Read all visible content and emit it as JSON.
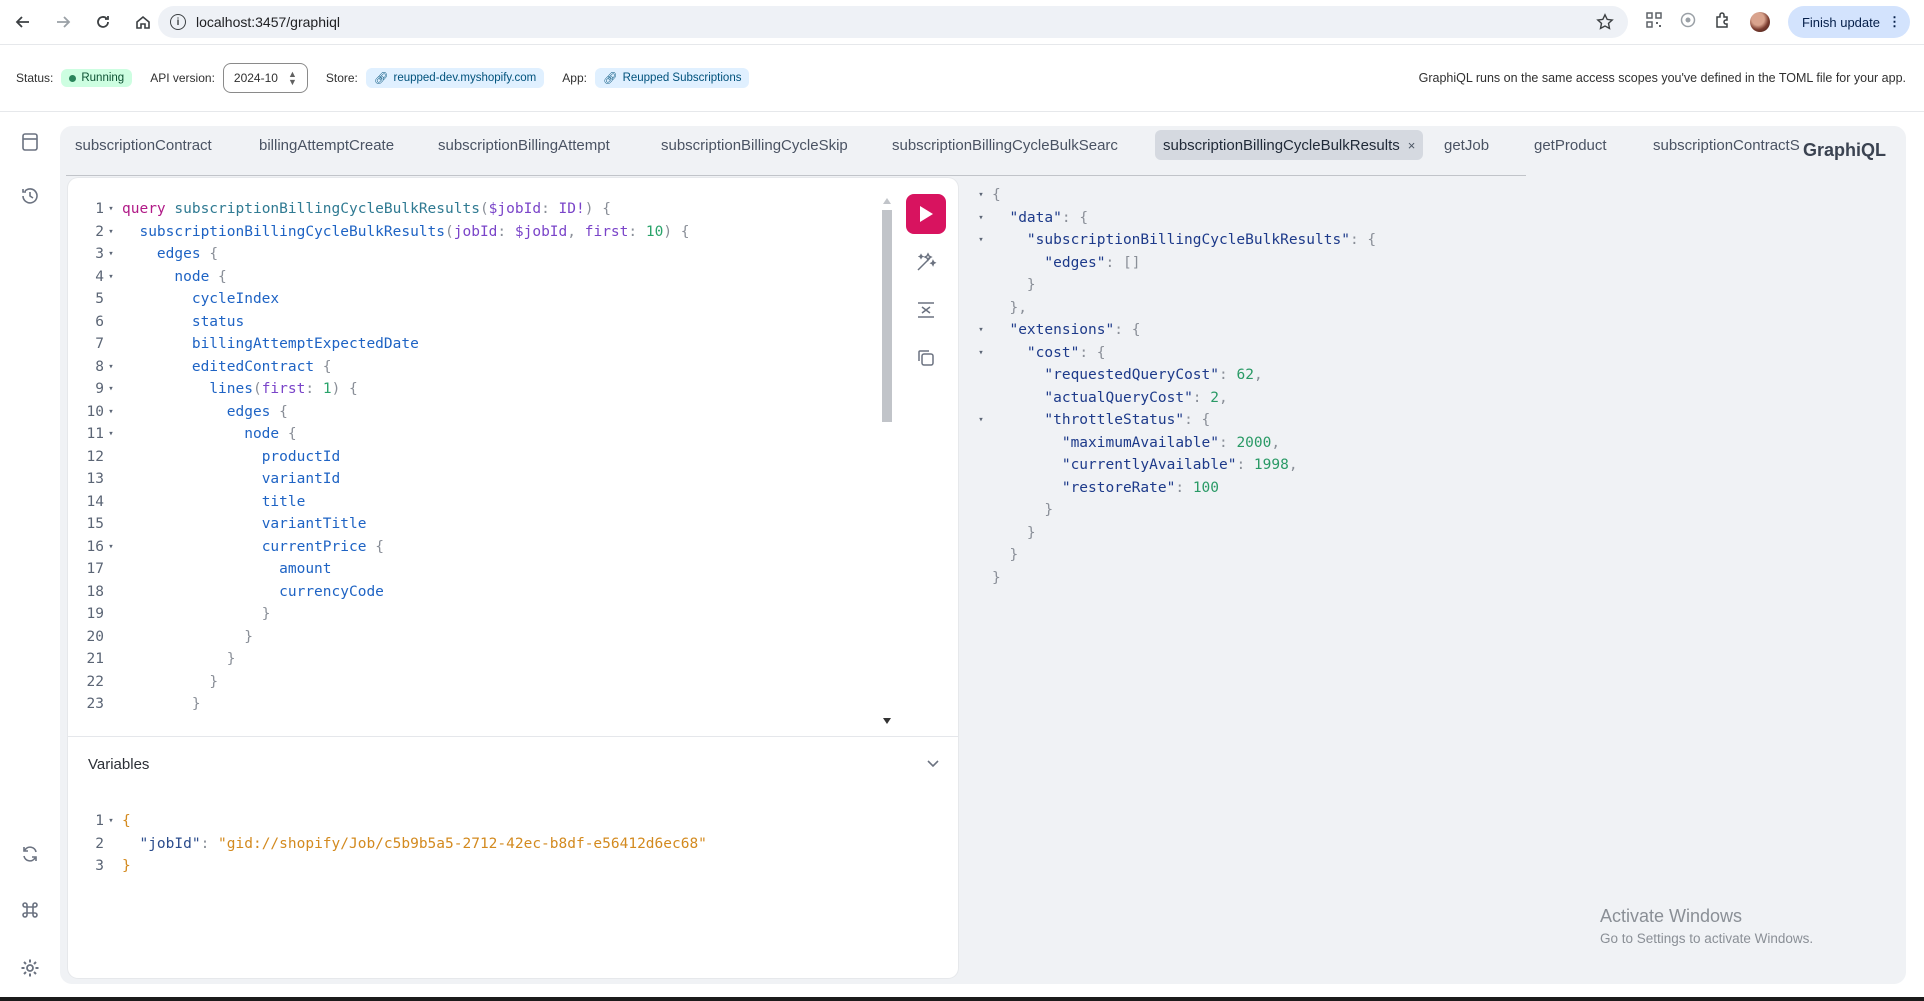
{
  "browser": {
    "url": "localhost:3457/graphiql",
    "finish_update_label": "Finish update"
  },
  "status_bar": {
    "status_label": "Status:",
    "status_value": "Running",
    "api_version_label": "API version:",
    "api_version_value": "2024-10",
    "store_label": "Store:",
    "store_value": "reupped-dev.myshopify.com",
    "app_label": "App:",
    "app_value": "Reupped Subscriptions",
    "note": "GraphiQL runs on the same access scopes you've defined in the TOML file for your app."
  },
  "tabs": [
    {
      "label": "subscriptionContract"
    },
    {
      "label": "billingAttemptCreate"
    },
    {
      "label": "subscriptionBillingAttempt"
    },
    {
      "label": "subscriptionBillingCycleSkip"
    },
    {
      "label": "subscriptionBillingCycleBulkSearc"
    },
    {
      "label": "subscriptionBillingCycleBulkResults",
      "active": true,
      "close": "×"
    },
    {
      "label": "getJob"
    },
    {
      "label": "getProduct"
    },
    {
      "label": "subscriptionContractS"
    }
  ],
  "brand": "GraphiQL",
  "query_lines": [
    {
      "n": "1",
      "fold": "▾"
    },
    {
      "n": "2",
      "fold": "▾"
    },
    {
      "n": "3",
      "fold": "▾"
    },
    {
      "n": "4",
      "fold": "▾"
    },
    {
      "n": "5"
    },
    {
      "n": "6"
    },
    {
      "n": "7"
    },
    {
      "n": "8",
      "fold": "▾"
    },
    {
      "n": "9",
      "fold": "▾"
    },
    {
      "n": "10",
      "fold": "▾"
    },
    {
      "n": "11",
      "fold": "▾"
    },
    {
      "n": "12"
    },
    {
      "n": "13"
    },
    {
      "n": "14"
    },
    {
      "n": "15"
    },
    {
      "n": "16",
      "fold": "▾"
    },
    {
      "n": "17"
    },
    {
      "n": "18"
    },
    {
      "n": "19"
    },
    {
      "n": "20"
    },
    {
      "n": "21"
    },
    {
      "n": "22"
    },
    {
      "n": "23"
    }
  ],
  "query_tokens": {
    "l1": {
      "kw": "query",
      "name": "subscriptionBillingCycleBulkResults",
      "open": "(",
      "var": "$jobId",
      "colon": ":",
      "type": "ID!",
      "close": ") {"
    },
    "l2": {
      "field": "subscriptionBillingCycleBulkResults",
      "open": "(",
      "arg1": "jobId",
      "c1": ":",
      "var": "$jobId",
      "comma": ",",
      "arg2": "first",
      "c2": ":",
      "num": "10",
      "close": ") {"
    },
    "l3": {
      "field": "edges",
      "brace": "{"
    },
    "l4": {
      "field": "node",
      "brace": "{"
    },
    "l5": {
      "field": "cycleIndex"
    },
    "l6": {
      "field": "status"
    },
    "l7": {
      "field": "billingAttemptExpectedDate"
    },
    "l8": {
      "field": "editedContract",
      "brace": "{"
    },
    "l9": {
      "field": "lines",
      "open": "(",
      "arg": "first",
      "colon": ":",
      "num": "1",
      "close": ") {"
    },
    "l10": {
      "field": "edges",
      "brace": "{"
    },
    "l11": {
      "field": "node",
      "brace": "{"
    },
    "l12": {
      "field": "productId"
    },
    "l13": {
      "field": "variantId"
    },
    "l14": {
      "field": "title"
    },
    "l15": {
      "field": "variantTitle"
    },
    "l16": {
      "field": "currentPrice",
      "brace": "{"
    },
    "l17": {
      "field": "amount"
    },
    "l18": {
      "field": "currencyCode"
    },
    "close": "}"
  },
  "variables": {
    "header": "Variables",
    "lines": [
      {
        "n": "1",
        "fold": "▾"
      },
      {
        "n": "2"
      },
      {
        "n": "3"
      }
    ],
    "open": "{",
    "key": "\"jobId\"",
    "colon": ":",
    "value": "\"gid://shopify/Job/c5b9b5a5-2712-42ec-b8df-e56412d6ec68\"",
    "close": "}"
  },
  "result": {
    "open": "{",
    "data_key": "\"data\"",
    "sbcbr_key": "\"subscriptionBillingCycleBulkResults\"",
    "edges_key": "\"edges\"",
    "edges_val": "[]",
    "extensions_key": "\"extensions\"",
    "cost_key": "\"cost\"",
    "requested_key": "\"requestedQueryCost\"",
    "requested_val": "62",
    "actual_key": "\"actualQueryCost\"",
    "actual_val": "2",
    "throttle_key": "\"throttleStatus\"",
    "max_key": "\"maximumAvailable\"",
    "max_val": "2000",
    "current_key": "\"currentlyAvailable\"",
    "current_val": "1998",
    "restore_key": "\"restoreRate\"",
    "restore_val": "100"
  },
  "watermark": {
    "title": "Activate Windows",
    "subtitle": "Go to Settings to activate Windows."
  },
  "colors": {
    "run_button": "#d8135f",
    "status_running_bg": "#cdfee1",
    "link_pill_bg": "#e0f0ff"
  }
}
